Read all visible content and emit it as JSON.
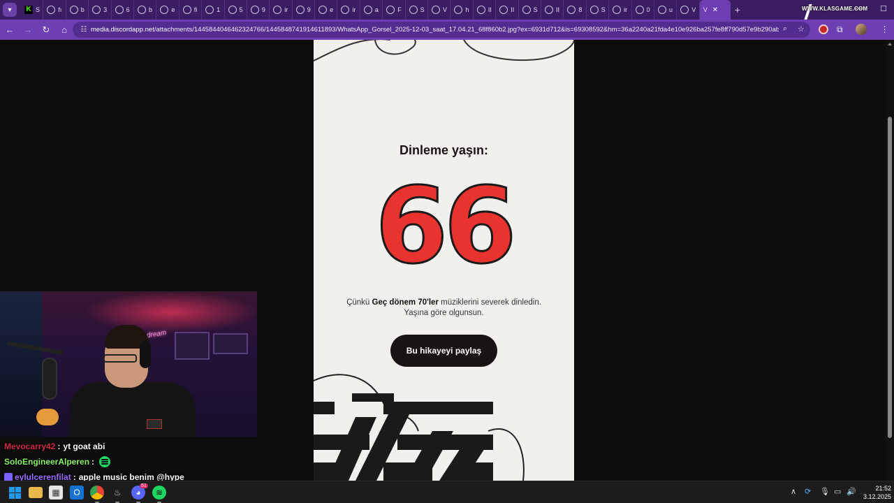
{
  "browser": {
    "tabs": [
      {
        "label": "S",
        "icon": "kick-icon"
      },
      {
        "label": "fı"
      },
      {
        "label": "b"
      },
      {
        "label": "3"
      },
      {
        "label": "6"
      },
      {
        "label": "b"
      },
      {
        "label": "e"
      },
      {
        "label": "fi"
      },
      {
        "label": "1"
      },
      {
        "label": "5"
      },
      {
        "label": "9"
      },
      {
        "label": "ir"
      },
      {
        "label": "9"
      },
      {
        "label": "e"
      },
      {
        "label": "ir"
      },
      {
        "label": "a"
      },
      {
        "label": "F"
      },
      {
        "label": "S"
      },
      {
        "label": "V"
      },
      {
        "label": "h"
      },
      {
        "label": "II"
      },
      {
        "label": "II"
      },
      {
        "label": "S"
      },
      {
        "label": "II"
      },
      {
        "label": "8"
      },
      {
        "label": "S"
      },
      {
        "label": "ir"
      },
      {
        "label": "0"
      },
      {
        "label": "u"
      },
      {
        "label": "V"
      }
    ],
    "active_tab": {
      "label": "V"
    },
    "new_tab": "+",
    "url_host": "media.discordapp.net",
    "url_path": "/attachments/1445844046462324766/1445848741914611893/WhatsApp_Gorsel_2025-12-03_saat_17.04.21_68f860b2.jpg?ex=6931d712&is=69308592&hm=36a2240a21fda4e10e926ba257fe8ff790d57e9b290ab672b...",
    "watermark": "WWW.KLASGAME.COM"
  },
  "story": {
    "heading": "Dinleme yaşın:",
    "age": "66",
    "desc_pre": "Çünkü ",
    "desc_bold": "Geç dönem 70'ler",
    "desc_post": " müziklerini severek dinledin.",
    "desc_line2": "Yaşına göre olgunsun.",
    "share_button": "Bu hikayeyi paylaş",
    "colors": {
      "background": "#f2f0ec",
      "number": "#e8332f",
      "button": "#191414"
    }
  },
  "webcam": {
    "neon_text": "dream"
  },
  "chat": [
    {
      "user": "Mevocarry42",
      "message": "yt goat abi"
    },
    {
      "user": "SoloEngineerAlperen",
      "message": "",
      "emote": "spotify-emote"
    },
    {
      "user": "eylulcerenfilat",
      "message": "apple music benim @hype",
      "badge": "sub-badge"
    }
  ],
  "taskbar": {
    "icons": [
      "windows-start-icon",
      "file-explorer-icon",
      "microsoft-store-icon",
      "outlook-icon",
      "chrome-icon",
      "steam-icon",
      "discord-icon",
      "spotify-icon"
    ],
    "discord_badge": "51",
    "time": "21:52",
    "date": "3.12.2025"
  }
}
